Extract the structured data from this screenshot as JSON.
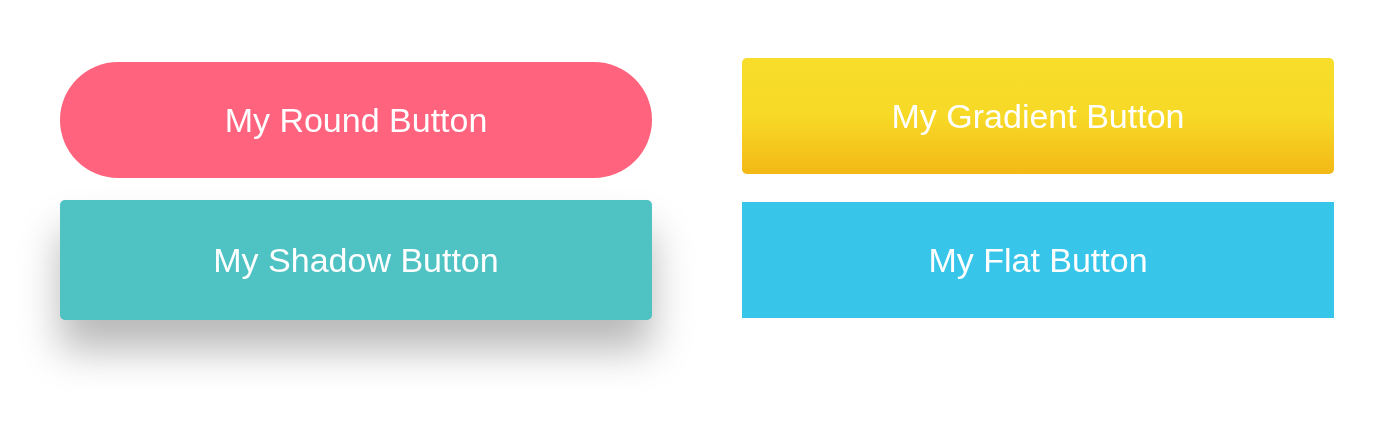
{
  "buttons": [
    {
      "kind": "round",
      "label": "My Round Button"
    },
    {
      "kind": "gradient",
      "label": "My Gradient Button"
    },
    {
      "kind": "shadow",
      "label": "My Shadow Button"
    },
    {
      "kind": "flat",
      "label": "My Flat Button"
    }
  ]
}
